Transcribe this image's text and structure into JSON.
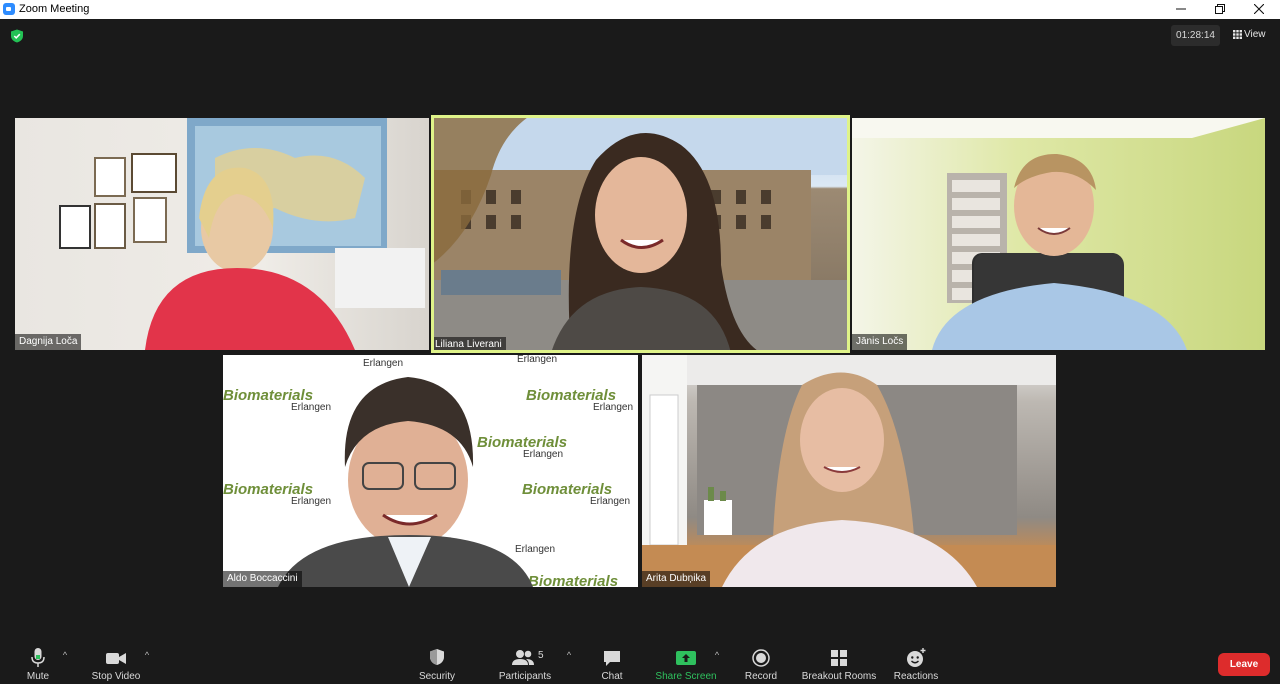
{
  "window": {
    "title": "Zoom Meeting"
  },
  "meeting": {
    "timer": "01:28:14",
    "view_label": "View"
  },
  "participants": [
    {
      "name": "Dagnija Loča"
    },
    {
      "name": "Liliana Liverani"
    },
    {
      "name": "Jānis Ločs"
    },
    {
      "name": "Aldo Boccaccini"
    },
    {
      "name": "Arita Dubņika"
    }
  ],
  "background_text": {
    "brand": "Biomaterials",
    "sub": "Erlangen"
  },
  "toolbar": {
    "mute": "Mute",
    "stop_video": "Stop Video",
    "security": "Security",
    "participants": "Participants",
    "participants_count": "5",
    "chat": "Chat",
    "share_screen": "Share Screen",
    "record": "Record",
    "breakout_rooms": "Breakout Rooms",
    "reactions": "Reactions",
    "leave": "Leave"
  },
  "colors": {
    "active_speaker": "#dff389",
    "leave": "#dd2c2c",
    "share": "#2fc05e",
    "shield": "#23c255"
  }
}
